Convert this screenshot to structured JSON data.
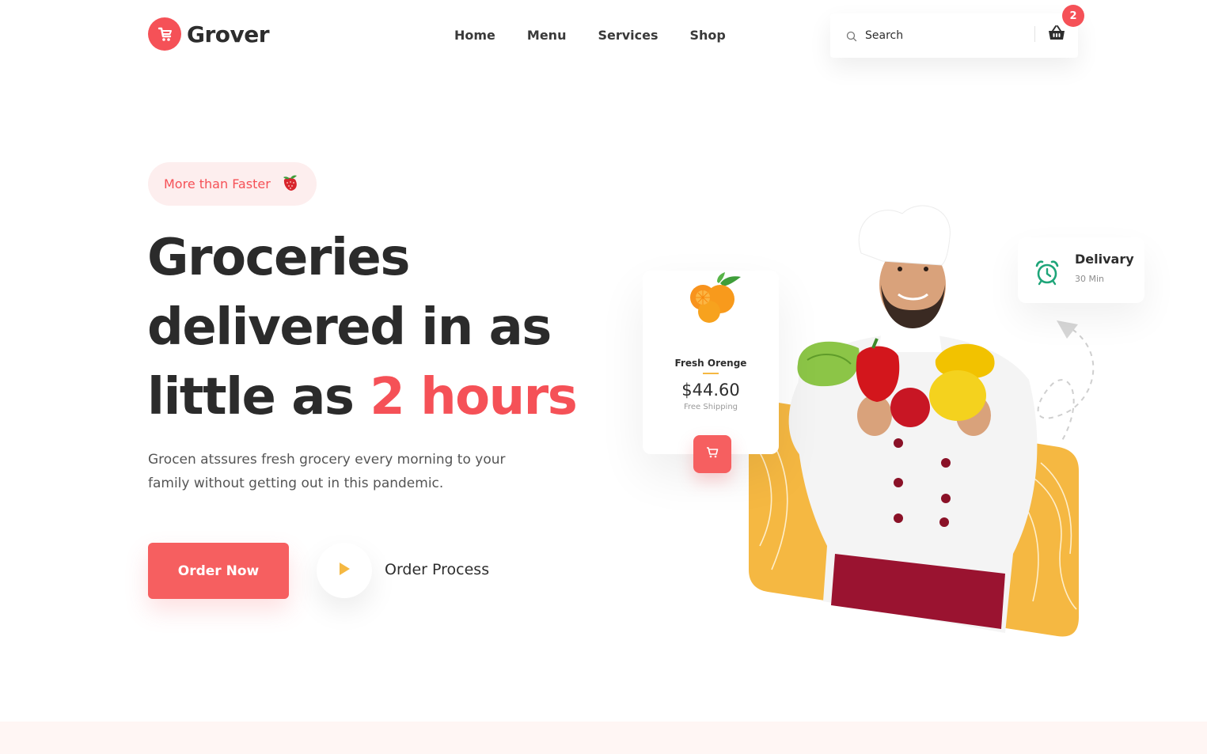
{
  "brand": {
    "name": "Grover",
    "color": "#f55157"
  },
  "nav": {
    "items": [
      "Home",
      "Menu",
      "Services",
      "Shop"
    ]
  },
  "search": {
    "placeholder": "Search"
  },
  "cart": {
    "count": "2"
  },
  "hero": {
    "badge": "More than Faster",
    "headline_line1": "Groceries",
    "headline_line2": "delivered in as",
    "headline_line3": "little as ",
    "headline_accent": "2 hours",
    "subtext": "Grocen atssures fresh grocery every morning to your family without getting out in this pandemic.",
    "order_button": "Order Now",
    "process_label": "Order Process"
  },
  "product": {
    "name": "Fresh Orenge",
    "price": "$44.60",
    "shipping": "Free Shipping"
  },
  "delivery": {
    "title": "Delivary",
    "time": "30 Min"
  },
  "colors": {
    "accent": "#f55157",
    "yellow": "#f5b842",
    "green": "#1ea579",
    "text": "#2d2d2d"
  },
  "icons": [
    "logo-cart-icon",
    "search-icon",
    "basket-icon",
    "strawberry-icon",
    "play-icon",
    "orange-fruit-icon",
    "cart-icon",
    "alarm-clock-icon"
  ]
}
